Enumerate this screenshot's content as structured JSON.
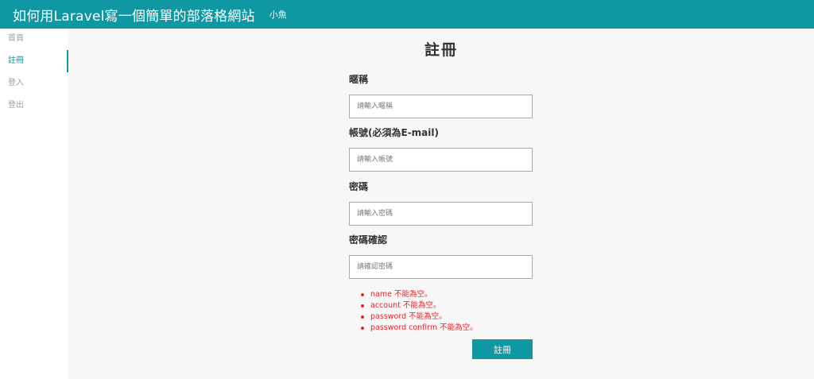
{
  "header": {
    "site_title": "如何用Laravel寫一個簡單的部落格網站",
    "user_name": "小魚"
  },
  "sidebar": {
    "items": [
      {
        "label": "首頁",
        "active": false
      },
      {
        "label": "註冊",
        "active": true
      },
      {
        "label": "登入",
        "active": false
      },
      {
        "label": "登出",
        "active": false
      }
    ]
  },
  "main": {
    "page_title": "註冊",
    "fields": [
      {
        "label": "暱稱",
        "value": "",
        "placeholder": "請輸入暱稱"
      },
      {
        "label": "帳號(必須為E-mail)",
        "value": "",
        "placeholder": "請輸入帳號"
      },
      {
        "label": "密碼",
        "value": "",
        "placeholder": "請輸入密碼"
      },
      {
        "label": "密碼確認",
        "value": "",
        "placeholder": "請確認密碼"
      }
    ],
    "errors": [
      "name 不能為空。",
      "account 不能為空。",
      "password 不能為空。",
      "password confirm 不能為空。"
    ],
    "submit_label": "註冊"
  },
  "colors": {
    "accent": "#0f97a2",
    "error": "#e1262b",
    "main_background": "#f7f7f7"
  }
}
